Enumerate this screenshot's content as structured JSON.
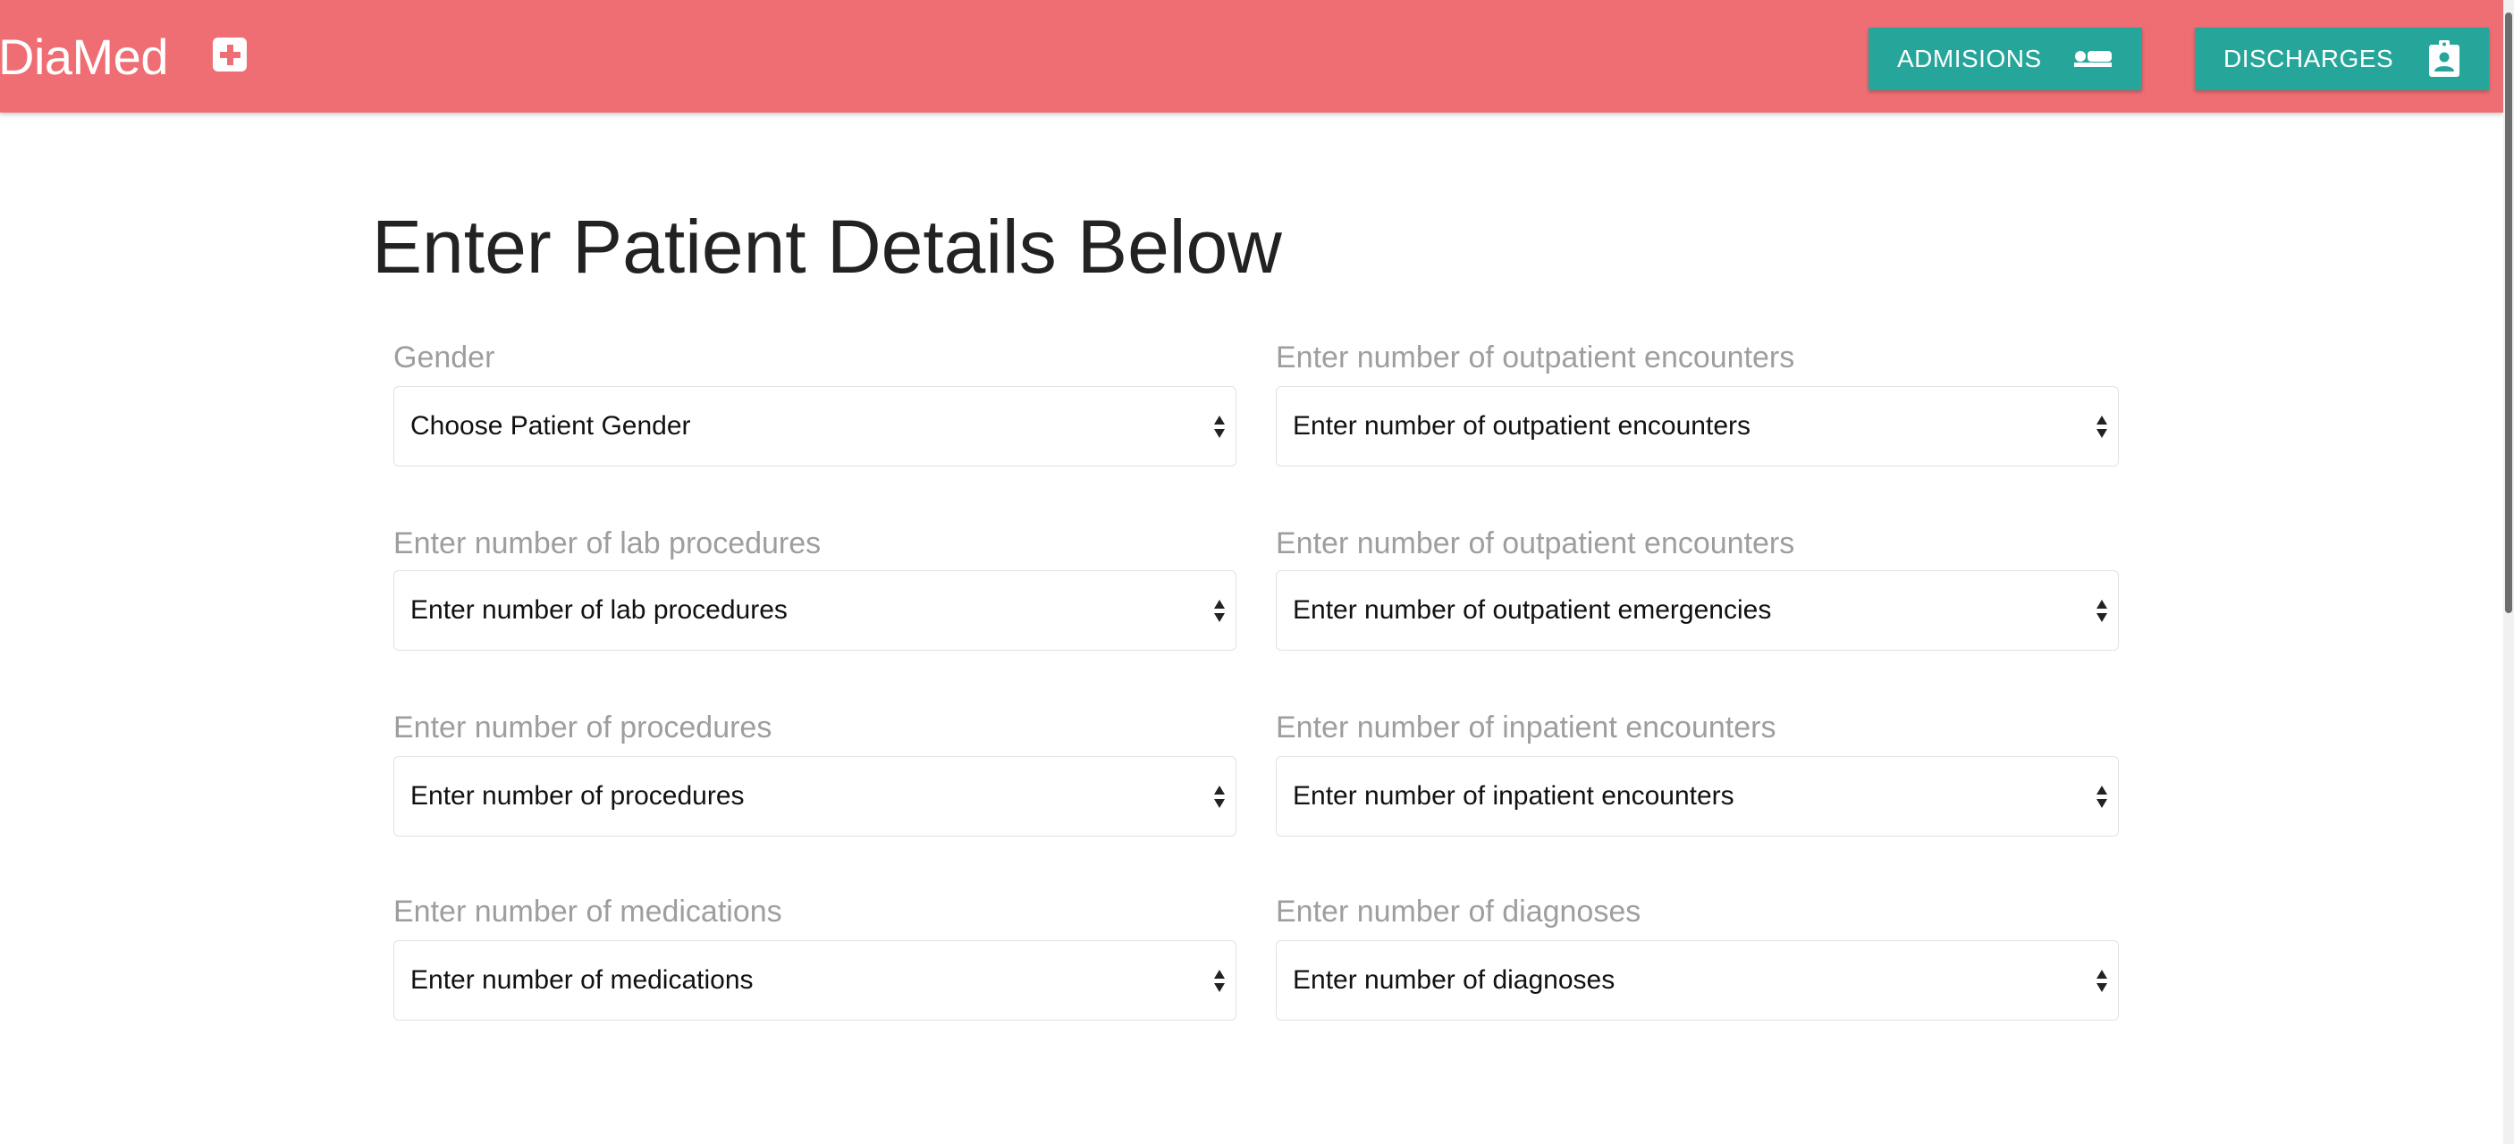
{
  "header": {
    "brand": "DiaMed",
    "brand_icon": "medical-cross-icon",
    "buttons": {
      "admisions": {
        "label": "ADMISIONS",
        "icon": "hotel-bed-icon"
      },
      "discharges": {
        "label": "DISCHARGES",
        "icon": "assignment-ind-icon"
      }
    }
  },
  "main": {
    "title": "Enter Patient Details Below",
    "fields": [
      {
        "label": "Gender",
        "value": "Choose Patient Gender"
      },
      {
        "label": "Enter number of outpatient encounters",
        "value": "Enter number of outpatient encounters"
      },
      {
        "label": "Enter number of lab procedures",
        "value": "Enter number of lab procedures"
      },
      {
        "label": "Enter number of outpatient encounters",
        "value": "Enter number of outpatient emergencies"
      },
      {
        "label": "Enter number of procedures",
        "value": "Enter number of procedures"
      },
      {
        "label": "Enter number of inpatient encounters",
        "value": "Enter number of inpatient encounters"
      },
      {
        "label": "Enter number of medications",
        "value": "Enter number of medications"
      },
      {
        "label": "Enter number of diagnoses",
        "value": "Enter number of diagnoses"
      }
    ]
  },
  "colors": {
    "header_bg": "#ef6e73",
    "button_bg": "#26a69a",
    "label_text": "#9e9e9e"
  }
}
